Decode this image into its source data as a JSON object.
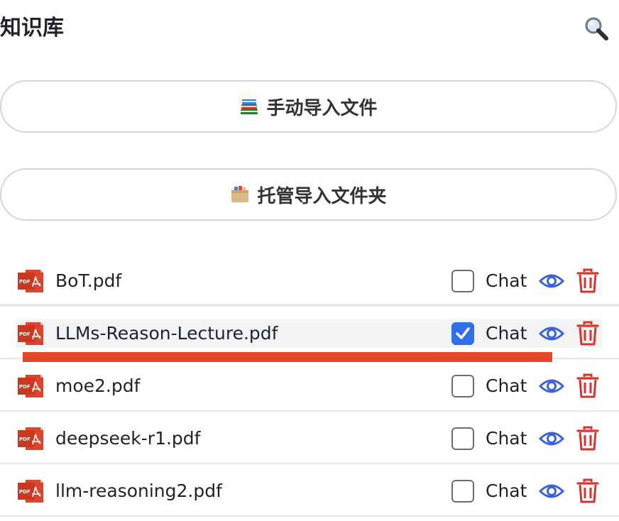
{
  "header": {
    "title": "知识库",
    "search_icon": "magnifier-icon"
  },
  "actions": {
    "manual_import": {
      "icon": "books-icon",
      "label": "手动导入文件"
    },
    "folder_import": {
      "icon": "file-cabinet-icon",
      "label": "托管导入文件夹"
    }
  },
  "files": [
    {
      "name": "BoT.pdf",
      "chat_label": "Chat",
      "chat_checked": false
    },
    {
      "name": "LLMs-Reason-Lecture.pdf",
      "chat_label": "Chat",
      "chat_checked": true
    },
    {
      "name": "moe2.pdf",
      "chat_label": "Chat",
      "chat_checked": false
    },
    {
      "name": "deepseek-r1.pdf",
      "chat_label": "Chat",
      "chat_checked": false
    },
    {
      "name": "llm-reasoning2.pdf",
      "chat_label": "Chat",
      "chat_checked": false
    }
  ],
  "colors": {
    "accent_blue": "#2f6fea",
    "eye_blue": "#3b63d9",
    "delete_red": "#d8342c",
    "pdf_red": "#d9462f",
    "highlight_red": "#e8452c"
  }
}
